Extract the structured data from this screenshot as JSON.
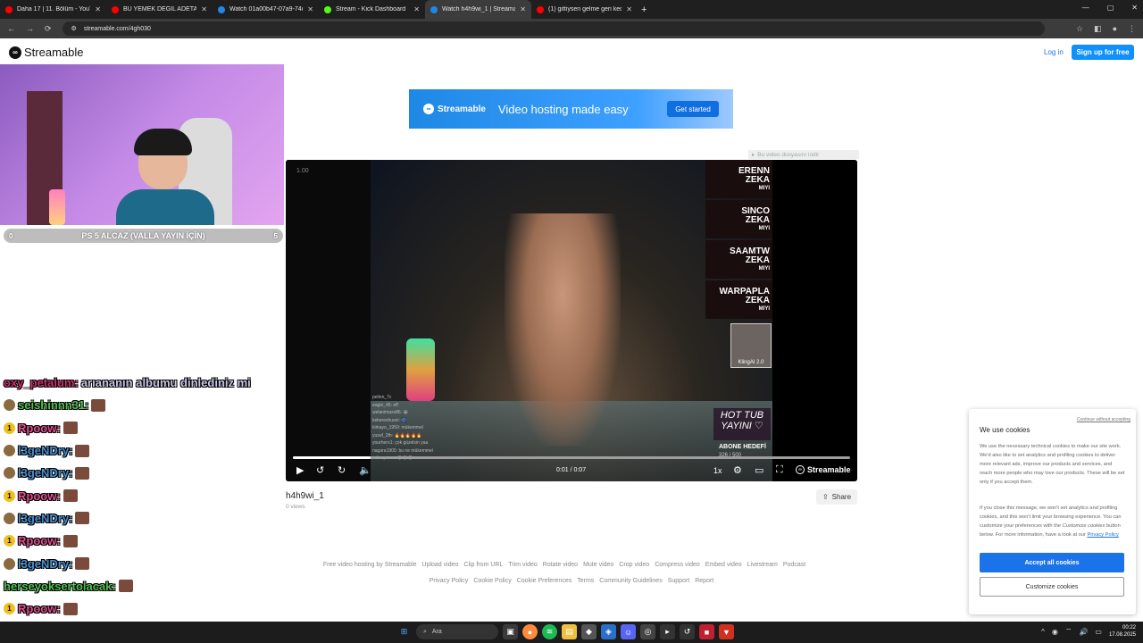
{
  "browser": {
    "tabs": [
      {
        "title": "Daha 17 | 11. Bölüm - YouTube",
        "color": "#ff0000"
      },
      {
        "title": "BU YEMEK DEĞİL ADETA ŞÖLEN",
        "color": "#ff0000"
      },
      {
        "title": "Watch 01a00b47-07a9-74d5-8",
        "color": "#1e88e5"
      },
      {
        "title": "Stream - Kick Dashboard",
        "color": "#53fc18"
      },
      {
        "title": "Watch h4h9wi_1 | Streamable",
        "color": "#1e88e5",
        "active": true
      },
      {
        "title": "(1) gittiysen gelme geri kedi 1",
        "color": "#ff0000"
      }
    ],
    "url": "streamable.com/4gh030"
  },
  "header": {
    "logo_text": "Streamable",
    "login": "Log in",
    "signup": "Sign up for free"
  },
  "stream_overlay": {
    "goal_left": "0",
    "goal_text": "PS 5 ALCAZ (VALLA YAYIN İÇİN)",
    "goal_right": "5",
    "chat": [
      {
        "user": "oxy_petalum:",
        "color": "#d03070",
        "badge": "",
        "message": "arıananın albumu dinlediniz mi",
        "emote": false
      },
      {
        "user": "seishinnn31:",
        "color": "#50c050",
        "badge": "avatar",
        "message": "",
        "emote": true
      },
      {
        "user": "Rpoow:",
        "color": "#e05090",
        "badge": "1",
        "message": "",
        "emote": true
      },
      {
        "user": "l3geNDry:",
        "color": "#4a90d0",
        "badge": "avatar",
        "message": "",
        "emote": true
      },
      {
        "user": "l3geNDry:",
        "color": "#4a90d0",
        "badge": "avatar",
        "message": "",
        "emote": true
      },
      {
        "user": "Rpoow:",
        "color": "#e05090",
        "badge": "1",
        "message": "",
        "emote": true
      },
      {
        "user": "l3geNDry:",
        "color": "#4a90d0",
        "badge": "avatar",
        "message": "",
        "emote": true
      },
      {
        "user": "Rpoow:",
        "color": "#e05090",
        "badge": "1",
        "message": "",
        "emote": true
      },
      {
        "user": "l3geNDry:",
        "color": "#4a90d0",
        "badge": "avatar",
        "message": "",
        "emote": true
      },
      {
        "user": "herseyoksertolacak:",
        "color": "#50c050",
        "badge": "",
        "message": "",
        "emote": true
      },
      {
        "user": "Rpoow:",
        "color": "#e05090",
        "badge": "1",
        "message": "",
        "emote": true
      },
      {
        "user": "Rpoow:",
        "color": "#e05090",
        "badge": "avatar",
        "message": "",
        "emote": true
      }
    ]
  },
  "ad": {
    "logo": "Streamable",
    "text": "Video hosting made easy",
    "button": "Get started"
  },
  "download_link": "Bu video dosyasını indir",
  "player": {
    "timestamp": "1.00",
    "time": "0:01 / 0:07",
    "progress": 0.14,
    "speed": "1x",
    "brand": "Streamable",
    "side_panels": [
      {
        "big": "ERENN",
        "big2": "ZEKA",
        "small": "MIYI"
      },
      {
        "big": "SINCO",
        "big2": "ZEKA",
        "small": "MIYI"
      },
      {
        "big": "SAAMTW",
        "big2": "ZEKA",
        "small": "MIYI"
      },
      {
        "big": "WARPAPLA",
        "big2": "ZEKA",
        "small": "MIYI"
      }
    ],
    "dog_label": "KlingAI 2.0",
    "hot_tub": "HOT TUB YAYINI ♡",
    "abone": "ABONE HEDEFİ",
    "abone_count": "326 / 500",
    "overlay_chat": [
      "pelinn_7c",
      "eagle_46: eff",
      "welanimaxx86: 😀",
      "kekereshusei: 🎆",
      "kirkayo_1950: mükemmel",
      "yusuf_2th: 🔥🔥🔥🔥🔥",
      "yourhero1: çok güzelsin yaa",
      "nagara1905: bu ne mükemmel",
      "sobrepacer: 😂😂😂"
    ]
  },
  "video": {
    "title": "h4h9wi_1",
    "views": "0 views",
    "share": "Share"
  },
  "footer": {
    "row1": [
      "Free video hosting by Streamable",
      "Upload video",
      "Clip from URL",
      "Trim video",
      "Rotate video",
      "Mute video",
      "Crop video",
      "Compress video",
      "Embed video",
      "Livestream",
      "Podcast"
    ],
    "row2": [
      "Privacy Policy",
      "Cookie Policy",
      "Cookie Preferences",
      "Terms",
      "Community Guidelines",
      "Support",
      "Report"
    ]
  },
  "cookie": {
    "continue": "Continue without accepting",
    "title": "We use cookies",
    "p1": "We use the necessary technical cookies to make our site work. We'd also like to set analytics and profiling cookies to deliver more relevant ads, improve our products and services, and reach more people who may love our products. These will be set only if you accept them.",
    "p2a": "If you close this message, we won't set analytics and profiling cookies, and this won't limit your browsing experience. You can customize your preferences with the ",
    "p2em": "Customize cookies",
    "p2b": " button below. For more information, have a look at our ",
    "p2link": "Privacy Policy",
    "accept": "Accept all cookies",
    "customize": "Customize cookies"
  },
  "taskbar": {
    "search": "Ara",
    "time": "00:22",
    "date": "17.08.2025"
  }
}
